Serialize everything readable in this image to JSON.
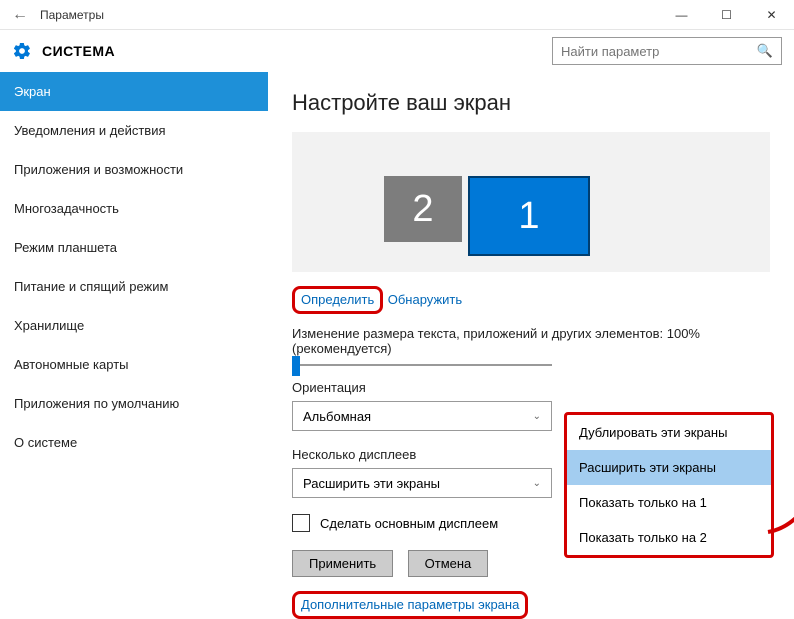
{
  "window": {
    "title": "Параметры"
  },
  "header": {
    "heading": "СИСТЕМА",
    "search_placeholder": "Найти параметр"
  },
  "sidebar": {
    "items": [
      "Экран",
      "Уведомления и действия",
      "Приложения и возможности",
      "Многозадачность",
      "Режим планшета",
      "Питание и спящий режим",
      "Хранилище",
      "Автономные карты",
      "Приложения по умолчанию",
      "О системе"
    ],
    "active_index": 0
  },
  "main": {
    "title": "Настройте ваш экран",
    "monitors": {
      "m2": "2",
      "m1": "1"
    },
    "identify_link": "Определить",
    "detect_link": "Обнаружить",
    "scale_label": "Изменение размера текста, приложений и других элементов: 100% (рекомендуется)",
    "orientation_label": "Ориентация",
    "orientation_value": "Альбомная",
    "multidisplay_label": "Несколько дисплеев",
    "multidisplay_value": "Расширить эти экраны",
    "make_primary": "Сделать основным дисплеем",
    "apply": "Применить",
    "cancel": "Отмена",
    "advanced_link": "Дополнительные параметры экрана"
  },
  "dropdown": {
    "options": [
      "Дублировать эти экраны",
      "Расширить эти экраны",
      "Показать только на 1",
      "Показать только на 2"
    ],
    "selected_index": 1
  }
}
